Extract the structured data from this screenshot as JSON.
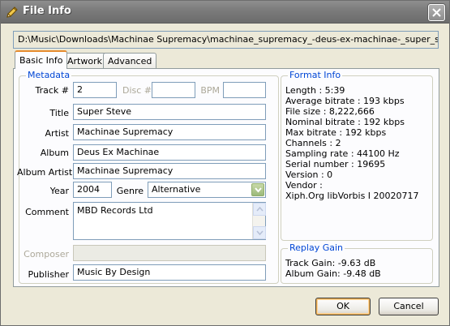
{
  "window": {
    "title": "File Info"
  },
  "file_path": "D:\\Music\\Downloads\\Machinae Supremacy\\machinae_supremacy_-deus-ex-machinae-_super_steve.ogg",
  "tabs": [
    {
      "label": "Basic Info",
      "active": true
    },
    {
      "label": "Artwork",
      "active": false
    },
    {
      "label": "Advanced",
      "active": false
    }
  ],
  "metadata": {
    "group_label": "Metadata",
    "track_label": "Track #",
    "track_value": "2",
    "disc_label": "Disc #",
    "disc_value": "",
    "bpm_label": "BPM",
    "bpm_value": "",
    "title_label": "Title",
    "title_value": "Super Steve",
    "artist_label": "Artist",
    "artist_value": "Machinae Supremacy",
    "album_label": "Album",
    "album_value": "Deus Ex Machinae",
    "album_artist_label": "Album Artist",
    "album_artist_value": "Machinae Supremacy",
    "year_label": "Year",
    "year_value": "2004",
    "genre_label": "Genre",
    "genre_value": "Alternative",
    "comment_label": "Comment",
    "comment_value": "MBD Records Ltd",
    "composer_label": "Composer",
    "composer_value": "",
    "publisher_label": "Publisher",
    "publisher_value": "Music By Design"
  },
  "format_info": {
    "group_label": "Format Info",
    "lines": [
      "Length : 5:39",
      "Average bitrate : 193 kbps",
      "File size : 8,222,666",
      "Nominal bitrate : 192 kbps",
      "Max bitrate : 192 kbps",
      "Channels : 2",
      "Sampling rate : 44100 Hz",
      "Serial number : 19695",
      "Version : 0",
      "Vendor :",
      "Xiph.Org libVorbis I 20020717"
    ]
  },
  "replay_gain": {
    "group_label": "Replay Gain",
    "lines": [
      "Track Gain: -9.63 dB",
      "Album Gain: -9.48 dB"
    ]
  },
  "buttons": {
    "ok": "OK",
    "cancel": "Cancel"
  },
  "icons": {
    "title_icon": "pencil-icon",
    "close": "close-icon",
    "genre_dropdown": "chevron-down-icon"
  },
  "colors": {
    "group_label": "#0046d5",
    "tab_highlight": "#e68b2c",
    "titlebar": "#7a7a7a"
  }
}
